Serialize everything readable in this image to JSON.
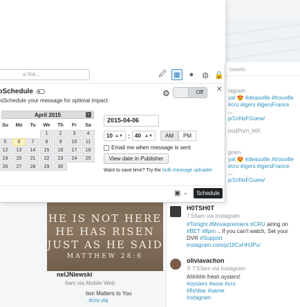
{
  "background": {
    "column_header": "tweets",
    "right_snippets": [
      {
        "meta": "tagram",
        "lines": [
          "yal 😍 #deauville #trouville",
          "#cru #igers #igersFrance",
          "..."
        ],
        "link": "p/1nNsFGuew/",
        "extra": "oodPorn_MX"
      },
      {
        "meta": "gram",
        "lines": [
          "yal 😍 #deauville #trouville",
          "#cru #igers #igersFrance",
          "..."
        ],
        "link": "p/1nNsFGuew/"
      }
    ],
    "image_lines": [
      "HE IS NOT HERE",
      "HE HAS RISEN",
      "JUST AS HE SAID",
      "MATTHEW 28:6"
    ],
    "left_post": {
      "author": "nelJNiewski",
      "meta": "6am via Mobile Web",
      "text_plain": "tion Matters to You",
      "text_link": ". #cru via"
    },
    "stream": [
      {
        "name": "H0TSH0T",
        "meta": "7:56am via Instagram",
        "text": [
          {
            "t": "#Tonight #Moviepremiere #CRU",
            "link": true
          },
          {
            "t": " airing on ",
            "link": false
          },
          {
            "t": "#BET #8pm",
            "link": true
          },
          {
            "t": " .. If you can't watch, Set your DVR ",
            "link": false
          },
          {
            "t": "#Support instagram.com/p/1lfCxHHJPs/",
            "link": true
          }
        ]
      },
      {
        "name": "oliviavachon",
        "meta": "⚲ 7:53am via Instagram",
        "text": [
          {
            "t": "Ahhhhh fresh oysters! ",
            "link": false
          },
          {
            "t": "#oysters #wow #cru #fishbar #same instagram",
            "link": true
          }
        ]
      }
    ]
  },
  "composer": {
    "link_placeholder": "a link...",
    "toolbar": [
      {
        "name": "attach-icon",
        "glyph": "🖉",
        "active": false
      },
      {
        "name": "calendar-icon",
        "glyph": "▦",
        "active": true
      },
      {
        "name": "location-icon",
        "glyph": "●",
        "active": false
      },
      {
        "name": "globe-icon",
        "glyph": "◍",
        "active": false
      },
      {
        "name": "lock-icon",
        "glyph": "🔒",
        "active": false
      }
    ],
    "autoschedule": {
      "title": "toSchedule",
      "subtitle": "toSchedule your message for optimal impact.",
      "toggle_label": "Off"
    },
    "calendar": {
      "month_label": "April 2015",
      "prev_label": "j",
      "next_label": "›",
      "weekdays": [
        "Su",
        "Mo",
        "Tu",
        "We",
        "Th",
        "Fr",
        "Sa"
      ],
      "weeks": [
        [
          "",
          "",
          "",
          "1",
          "2",
          "3",
          "4"
        ],
        [
          "5",
          "6",
          "7",
          "8",
          "9",
          "10",
          "11"
        ],
        [
          "12",
          "13",
          "14",
          "15",
          "16",
          "17",
          "18"
        ],
        [
          "19",
          "20",
          "21",
          "22",
          "23",
          "24",
          "25"
        ],
        [
          "26",
          "27",
          "28",
          "29",
          "30",
          "",
          ""
        ]
      ],
      "today": "6"
    },
    "date_value": "2015-04-06",
    "hour": "10",
    "minute": "40",
    "am_label": "AM",
    "pm_label": "PM",
    "email_label": "Email me when message is sent",
    "view_button": "View date in Publisher",
    "tip_text": "Want to save time? Try the ",
    "tip_link": "bulk message uploader",
    "schedule_button": "Schedule"
  }
}
